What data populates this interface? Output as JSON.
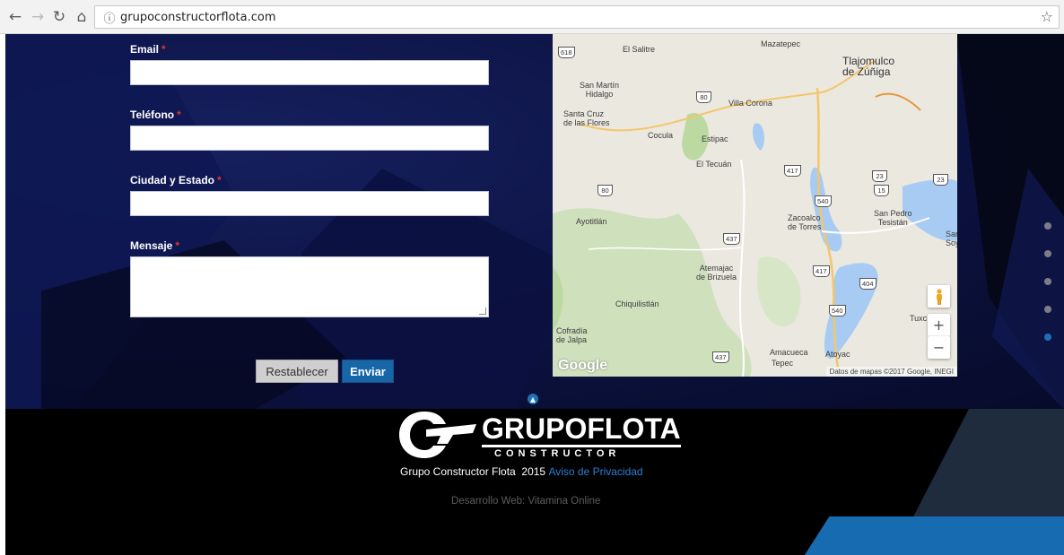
{
  "browser": {
    "url": "grupoconstructorflota.com",
    "back_icon": "arrow-left-icon",
    "forward_icon": "arrow-right-icon",
    "reload_icon": "reload-icon",
    "home_icon": "home-icon",
    "info_icon": "info-icon",
    "bookmark_icon": "star-icon"
  },
  "form": {
    "fields": [
      {
        "label": "Email",
        "required": "*",
        "value": ""
      },
      {
        "label": "Teléfono",
        "required": "*",
        "value": ""
      },
      {
        "label": "Ciudad y Estado",
        "required": "*",
        "value": ""
      },
      {
        "label": "Mensaje",
        "required": "*",
        "value": ""
      }
    ],
    "reset_label": "Restablecer",
    "submit_label": "Enviar",
    "required_color": "#e0322d",
    "submit_color": "#1766a8"
  },
  "map": {
    "labels": {
      "mazatepec": "Mazatepec",
      "el_salitre": "El Salitre",
      "tlajomulco": "Tlajomulco\nde Zúñiga",
      "san_martin": "San Martín\nHidalgo",
      "villa_corona": "Villa Corona",
      "santa_cruz": "Santa Cruz\nde las Flores",
      "cocula": "Cocula",
      "estipac": "Estipac",
      "el_tecuan": "El Tecuán",
      "ayotitlan": "Ayotitlán",
      "zacoalco": "Zacoalco\nde Torres",
      "san_pedro": "San Pedro\nTesistán",
      "san_soy": "San\nSoy",
      "atemajac": "Atemajac\nde Brizuela",
      "chiquilistlan": "Chiquilistlán",
      "cofradia": "Cofradía\nde Jalpa",
      "tuxc": "Tuxc",
      "amacueca": "Amacueca",
      "atoyac": "Atoyac",
      "tepec": "Tepec"
    },
    "shields": [
      "618",
      "80",
      "80",
      "417",
      "540",
      "23",
      "15",
      "23",
      "437",
      "417",
      "404",
      "540",
      "437"
    ],
    "google_logo": "Google",
    "attribution": "Datos de mapas ©2017 Google, INEGI",
    "pegman_icon": "pegman-icon",
    "zoom_in": "+",
    "zoom_out": "−"
  },
  "dot_nav": {
    "count": 5,
    "active_index": 4,
    "active_color": "#1f6dbb"
  },
  "footer": {
    "back_to_top_icon": "chevron-up-icon",
    "brand": "GRUPOFLOTA",
    "brand_sub": "CONSTRUCTOR",
    "copyright": "Grupo Constructor Flota",
    "year": "2015",
    "privacy_link": "Aviso de Privacidad",
    "developer": "Desarrollo Web: Vitamina Online",
    "link_color": "#2f7fd3"
  }
}
